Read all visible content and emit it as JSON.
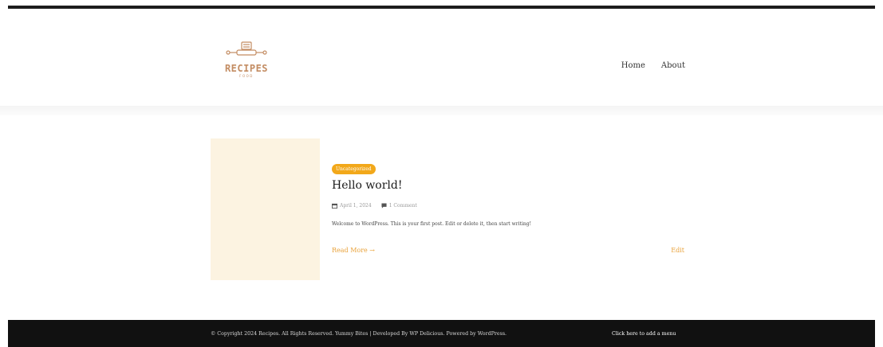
{
  "header": {
    "logo": {
      "text": "RECIPES",
      "subtext": "FOOD"
    },
    "nav": [
      {
        "label": "Home"
      },
      {
        "label": "About"
      }
    ]
  },
  "post": {
    "category": "Uncategorized",
    "title": "Hello world!",
    "date": "April 1, 2024",
    "comments": "1 Comment",
    "excerpt": "Welcome to WordPress. This is your first post. Edit or delete it, then start writing!",
    "read_more": "Read More →",
    "edit": "Edit"
  },
  "footer": {
    "copyright": "© Copyright 2024 Recipes. All Rights Reserved. Yummy Bites | Developed By WP Delicious. Powered by WordPress.",
    "menu_link": "Click here to add a menu"
  },
  "colors": {
    "accent": "#f2a81a",
    "link": "#e9a23b",
    "logo": "#c38c62",
    "thumbnail": "#fcf3e1",
    "footer_bg": "#111111"
  }
}
